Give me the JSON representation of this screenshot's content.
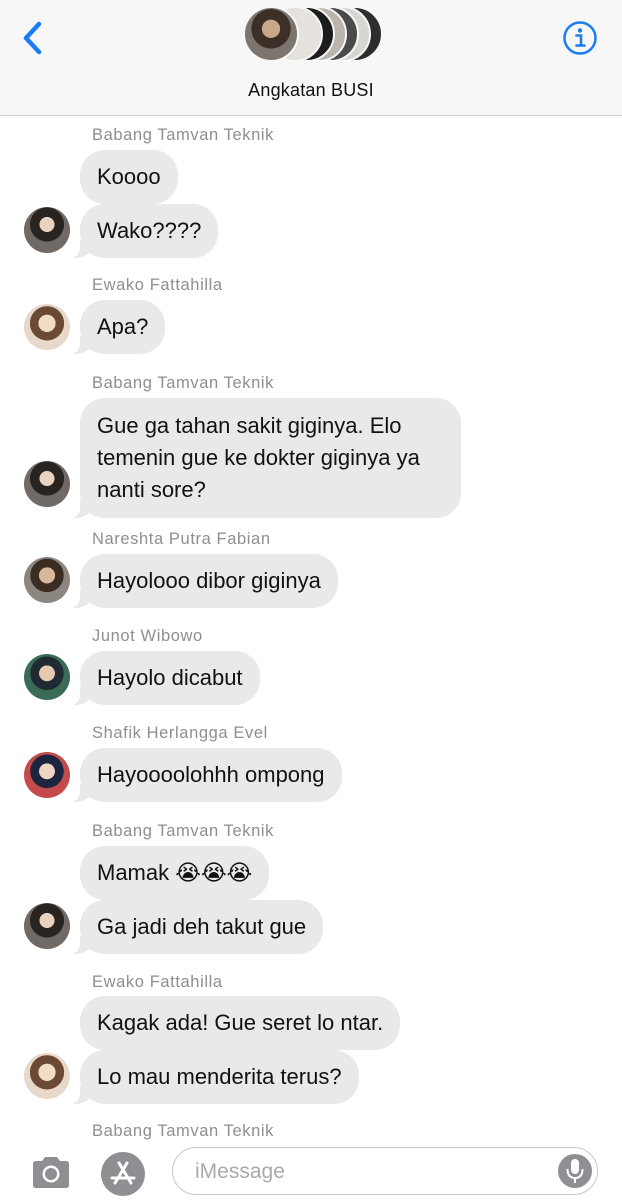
{
  "header": {
    "group_name": "Angkatan BUSI",
    "back_icon": "chevron-left-icon",
    "info_icon": "info-icon",
    "accent_color": "#1a7cf5"
  },
  "messages": [
    {
      "sender": "Babang Tamvan Teknik",
      "bubbles": [
        "Koooo",
        "Wako????"
      ]
    },
    {
      "sender": "Ewako Fattahilla",
      "bubbles": [
        "Apa?"
      ]
    },
    {
      "sender": "Babang Tamvan Teknik",
      "bubbles": [
        "Gue ga tahan sakit giginya. Elo temenin gue ke dokter giginya ya nanti sore?"
      ]
    },
    {
      "sender": "Nareshta Putra Fabian",
      "bubbles": [
        "Hayolooo dibor giginya"
      ]
    },
    {
      "sender": "Junot Wibowo",
      "bubbles": [
        "Hayolo dicabut"
      ]
    },
    {
      "sender": "Shafik Herlangga Evel",
      "bubbles": [
        "Hayoooolohhh ompong"
      ]
    },
    {
      "sender": "Babang Tamvan Teknik",
      "bubbles": [
        "Mamak 😭😭😭",
        "Ga jadi deh takut gue"
      ]
    },
    {
      "sender": "Ewako Fattahilla",
      "bubbles": [
        "Kagak ada! Gue seret lo ntar.",
        "Lo mau menderita terus?"
      ]
    },
    {
      "sender": "Babang Tamvan Teknik",
      "bubbles": []
    }
  ],
  "composer": {
    "placeholder": "iMessage",
    "camera_icon": "camera-icon",
    "apps_icon": "app-store-icon",
    "mic_icon": "microphone-icon"
  }
}
